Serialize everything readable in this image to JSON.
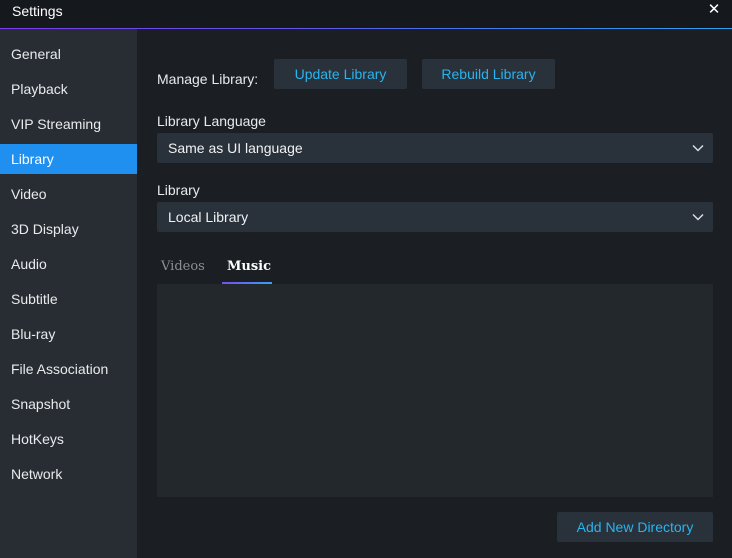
{
  "window": {
    "title": "Settings",
    "close_glyph": "✕"
  },
  "sidebar": {
    "items": [
      {
        "label": "General"
      },
      {
        "label": "Playback"
      },
      {
        "label": "VIP Streaming"
      },
      {
        "label": "Library"
      },
      {
        "label": "Video"
      },
      {
        "label": "3D Display"
      },
      {
        "label": "Audio"
      },
      {
        "label": "Subtitle"
      },
      {
        "label": "Blu-ray"
      },
      {
        "label": "File Association"
      },
      {
        "label": "Snapshot"
      },
      {
        "label": "HotKeys"
      },
      {
        "label": "Network"
      }
    ],
    "active": "Library"
  },
  "library": {
    "manage_label": "Manage Library:",
    "update_button": "Update Library",
    "rebuild_button": "Rebuild Library",
    "language_label": "Library Language",
    "language_value": "Same as UI language",
    "library_label": "Library",
    "library_value": "Local Library",
    "tabs": [
      {
        "label": "Videos",
        "active": false
      },
      {
        "label": "Music",
        "active": true
      }
    ],
    "add_directory_button": "Add New Directory"
  },
  "colors": {
    "accent": "#1f8ff0",
    "button_text": "#28b4f0",
    "sidebar_bg": "#272d33",
    "main_bg": "#1b1f24"
  }
}
